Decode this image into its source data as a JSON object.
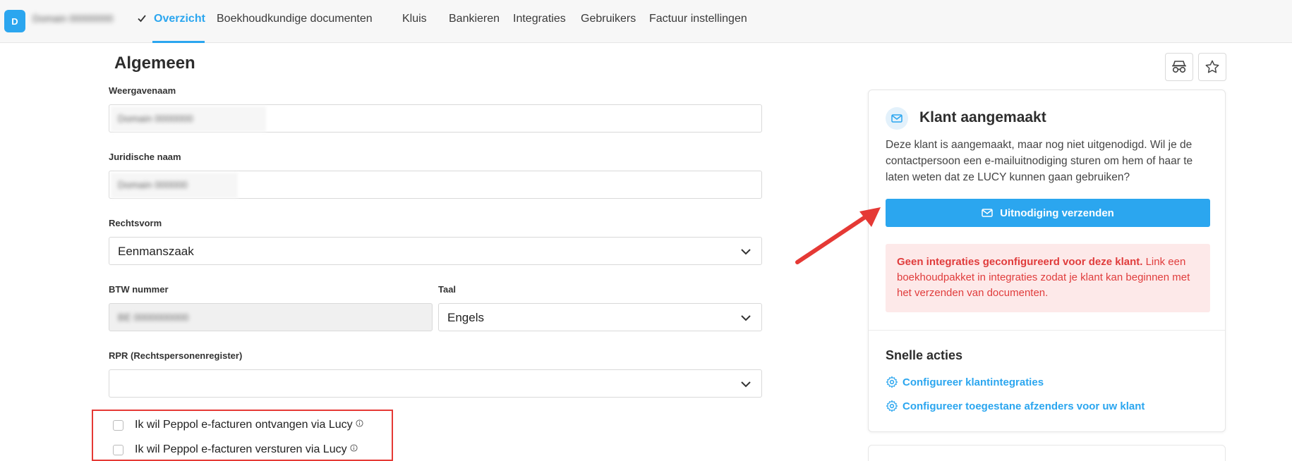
{
  "colors": {
    "accent": "#2ba6ef",
    "alert_text": "#e03c3c",
    "alert_bg": "#fde9e9",
    "annotation_red": "#e53935"
  },
  "header": {
    "avatar_letter": "D",
    "client_name": "Domain 00000000",
    "tabs": [
      {
        "label": "Overzicht",
        "active": true
      },
      {
        "label": "Boekhoudkundige documenten",
        "active": false
      },
      {
        "label": "Kluis",
        "active": false
      },
      {
        "label": "Bankieren",
        "active": false
      },
      {
        "label": "Integraties",
        "active": false
      },
      {
        "label": "Gebruikers",
        "active": false
      },
      {
        "label": "Factuur instellingen",
        "active": false
      }
    ]
  },
  "form": {
    "title": "Algemeen",
    "display_name": {
      "label": "Weergavenaam",
      "value": "Domain 0000000"
    },
    "legal_name": {
      "label": "Juridische naam",
      "value": "Domain 000000"
    },
    "legal_form": {
      "label": "Rechtsvorm",
      "value": "Eenmanszaak"
    },
    "vat": {
      "label": "BTW nummer",
      "value": "BE 0000000000"
    },
    "language": {
      "label": "Taal",
      "value": "Engels"
    },
    "rpr": {
      "label": "RPR (Rechtspersonenregister)",
      "value": ""
    },
    "checkboxes": [
      {
        "label": "Ik wil Peppol e-facturen ontvangen via Lucy",
        "checked": false
      },
      {
        "label": "Ik wil Peppol e-facturen versturen via Lucy",
        "checked": false
      }
    ]
  },
  "panel": {
    "icons": [
      "incognito-icon",
      "star-icon"
    ],
    "card_title": "Klant aangemaakt",
    "card_desc": "Deze klant is aangemaakt, maar nog niet uitgenodigd. Wil je de contactpersoon een e-mailuitnodiging sturen om hem of haar te laten weten dat ze LUCY kunnen gaan gebruiken?",
    "invite_button": "Uitnodiging verzenden",
    "alert_bold": "Geen integraties geconfigureerd voor deze klant.",
    "alert_text": " Link een boekhoudpakket in integraties zodat je klant kan beginnen met het verzenden van documenten.",
    "quick_actions_title": "Snelle acties",
    "quick_links": [
      "Configureer klantintegraties",
      "Configureer toegestane afzenders voor uw klant"
    ]
  }
}
